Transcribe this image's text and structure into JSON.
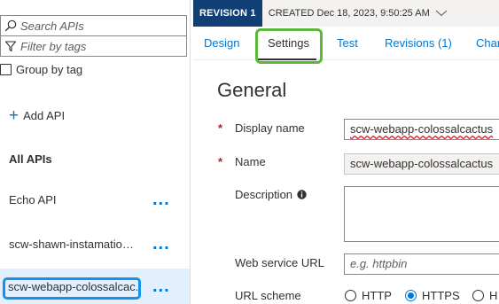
{
  "search": {
    "placeholder": "Search APIs"
  },
  "filter": {
    "placeholder": "Filter by tags"
  },
  "group_by_tag": {
    "label": "Group by tag",
    "checked": false
  },
  "add_api": {
    "label": "Add API"
  },
  "all_apis": {
    "label": "All APIs"
  },
  "apis": [
    {
      "name": "Echo API",
      "more": "..."
    },
    {
      "name": "scw-shawn-instamationtest",
      "display": "scw-shawn-instamationt...",
      "more": "..."
    },
    {
      "name": "scw-webapp-colossalcac.",
      "more": "...",
      "selected": true
    }
  ],
  "revision": {
    "badge": "REVISION 1",
    "created": "CREATED Dec 18, 2023, 9:50:25 AM"
  },
  "tabs": [
    {
      "label": "Design"
    },
    {
      "label": "Settings",
      "active": true
    },
    {
      "label": "Test"
    },
    {
      "label": "Revisions (1)"
    },
    {
      "label": "Char"
    }
  ],
  "section": {
    "title": "General"
  },
  "form": {
    "required_mark": "*",
    "display_name": {
      "label": "Display name",
      "value": "scw-webapp-colossalcactus"
    },
    "name": {
      "label": "Name",
      "value": "scw-webapp-colossalcactus"
    },
    "description": {
      "label": "Description",
      "value": ""
    },
    "web_service_url": {
      "label": "Web service URL",
      "placeholder": "e.g. httpbin"
    },
    "url_scheme": {
      "label": "URL scheme",
      "options": [
        {
          "label": "HTTP",
          "selected": false
        },
        {
          "label": "HTTPS",
          "selected": true
        },
        {
          "label": "H",
          "selected": false
        }
      ]
    }
  },
  "colors": {
    "accent": "#0078d4",
    "revision_badge": "#0f3f75",
    "settings_highlight": "#5cb83a",
    "selected_api_highlight": "#1890e6",
    "required": "#a4262c"
  }
}
